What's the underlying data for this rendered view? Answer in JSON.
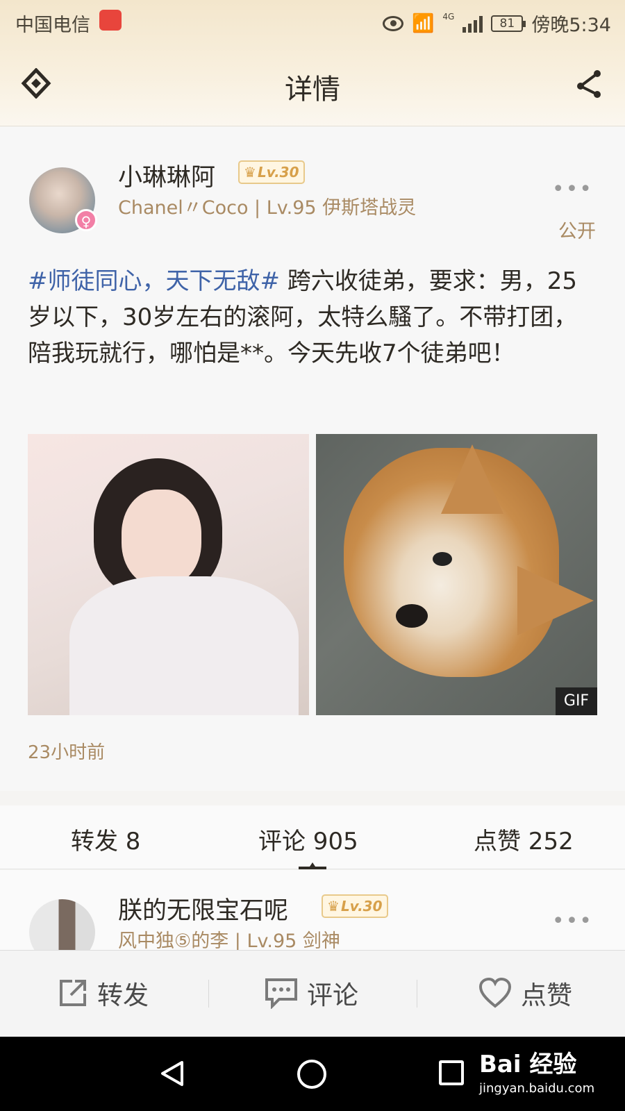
{
  "status_bar": {
    "carrier": "中国电信",
    "network": "4G",
    "battery": "81",
    "time": "傍晚5:34"
  },
  "header": {
    "title": "详情",
    "back_icon": "back-diamond-icon",
    "share_icon": "share-icon"
  },
  "post": {
    "username": "小琳琳阿",
    "level_badge": "Lv.30",
    "subtitle": "Chanel〃Coco | Lv.95 伊斯塔战灵",
    "visibility": "公开",
    "more": "•••",
    "hashtag": "#师徒同心，天下无敌#",
    "text": " 跨六收徒弟，要求：男，25岁以下，30岁左右的滚阿，太特么騷了。不带打团，陪我玩就行，哪怕是**。今天先收7个徒弟吧！",
    "gif_label": "GIF",
    "time": "23小时前"
  },
  "stats": {
    "repost": "转发 8",
    "comments": "评论 905",
    "likes": "点赞 252"
  },
  "comment": {
    "username": "朕的无限宝石呢",
    "level_badge": "Lv.30",
    "subtitle": "风中独⑤的李 | Lv.95 剑神",
    "more": "•••"
  },
  "actions": {
    "repost": "转发",
    "comment": "评论",
    "like": "点赞"
  },
  "watermark": {
    "brand": "Bai 经验",
    "url": "jingyan.baidu.com"
  },
  "colors": {
    "accent_gold": "#a98a63",
    "hashtag_blue": "#3f63a8",
    "gender_pink": "#f27fa6"
  }
}
